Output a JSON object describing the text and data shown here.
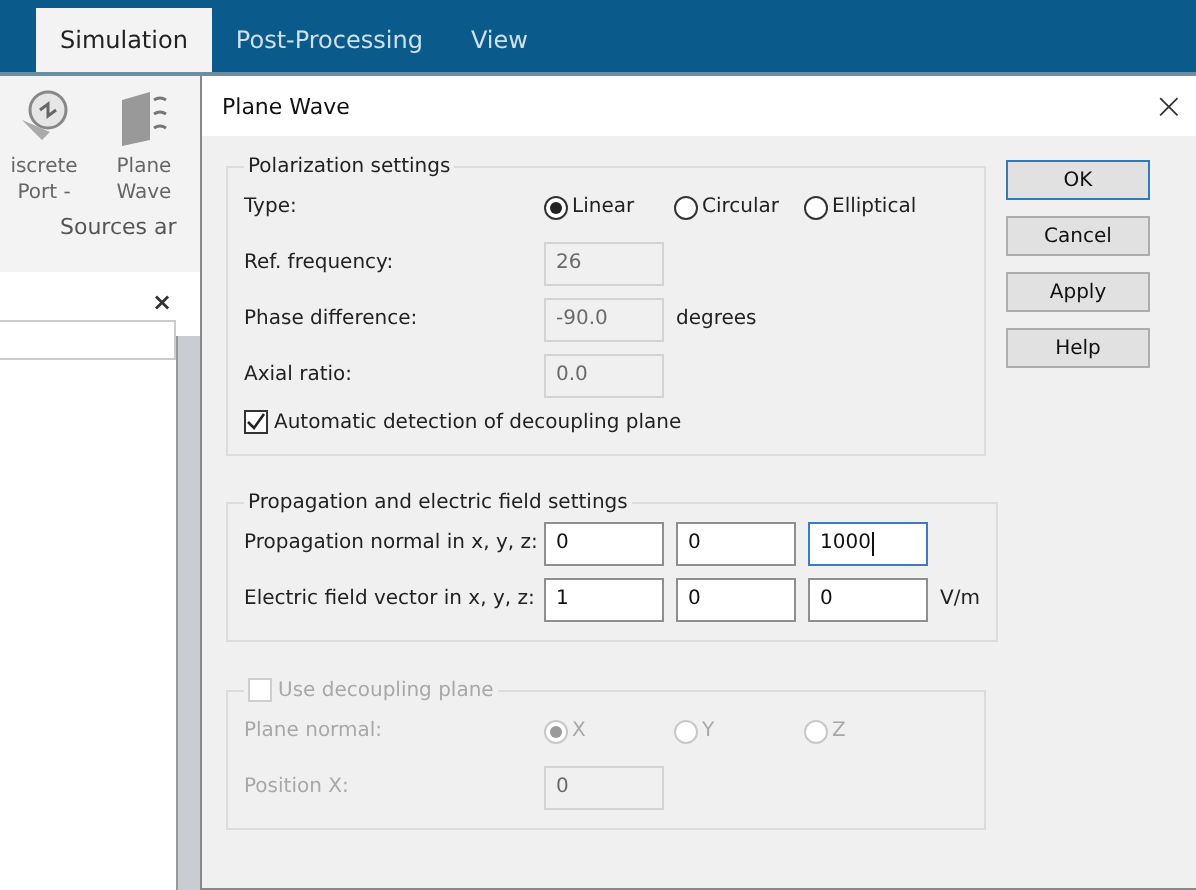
{
  "ribbon": {
    "tabs": [
      {
        "label": "Simulation",
        "selected": true
      },
      {
        "label": "Post-Processing",
        "selected": false
      },
      {
        "label": "View",
        "selected": false
      }
    ],
    "tools": [
      {
        "kind": "port",
        "label": "iscrete Port",
        "dropdown": "-"
      },
      {
        "kind": "wave",
        "label": "Plane Wave"
      }
    ],
    "group_label": "Sources ar"
  },
  "side_panel": {
    "close": "×"
  },
  "dialog": {
    "title": "Plane Wave",
    "close": "×",
    "polarization": {
      "title": "Polarization settings",
      "type_label": "Type:",
      "types": [
        {
          "label": "Linear",
          "selected": true
        },
        {
          "label": "Circular",
          "selected": false
        },
        {
          "label": "Elliptical",
          "selected": false
        }
      ],
      "fields": [
        {
          "label": "Ref. frequency:",
          "value": "26",
          "disabled": true
        },
        {
          "label": "Phase difference:",
          "value": "-90.0",
          "unit": "degrees",
          "disabled": true
        },
        {
          "label": "Axial ratio:",
          "value": "0.0",
          "disabled": true
        }
      ],
      "auto_detect": {
        "label": "Automatic detection of decoupling plane",
        "checked": true
      }
    },
    "propagation": {
      "title": "Propagation and electric field settings",
      "rows": [
        {
          "label": "Propagation normal in x, y, z:",
          "values": [
            {
              "value": "0",
              "focused": false
            },
            {
              "value": "0",
              "focused": false
            },
            {
              "value": "1000",
              "focused": true
            }
          ]
        },
        {
          "label": "Electric field vector in x, y, z:",
          "values": [
            {
              "value": "1",
              "focused": false
            },
            {
              "value": "0",
              "focused": false
            },
            {
              "value": "0",
              "focused": false
            }
          ],
          "unit": "V/m"
        }
      ]
    },
    "decoupling": {
      "label": "Use decoupling plane",
      "checked": false,
      "disabled": true,
      "normal_label": "Plane normal:",
      "normals": [
        {
          "label": "X",
          "selected": true
        },
        {
          "label": "Y",
          "selected": false
        },
        {
          "label": "Z",
          "selected": false
        }
      ],
      "position_label": "Position X:",
      "position_value": "0"
    },
    "buttons": [
      {
        "label": "OK",
        "default": true
      },
      {
        "label": "Cancel",
        "default": false
      },
      {
        "label": "Apply",
        "default": false
      },
      {
        "label": "Help",
        "default": false
      }
    ]
  }
}
